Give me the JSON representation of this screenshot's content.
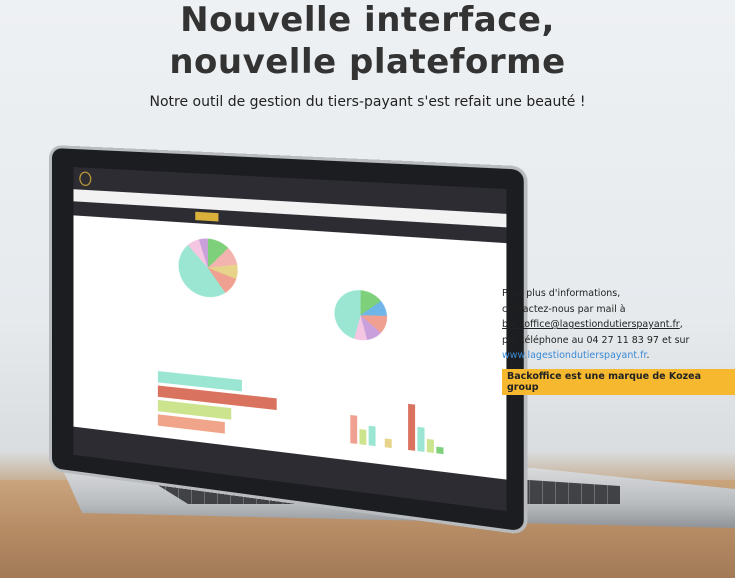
{
  "headline": {
    "line1": "Nouvelle interface,",
    "line2": "nouvelle plateforme"
  },
  "subtitle": "Notre outil de gestion du tiers-payant s'est refait une beauté !",
  "info": {
    "line1": "Pour plus d'informations,",
    "line2": "contactez-nous par mail à",
    "email": "backoffice@lagestiondutierspayant.fr",
    "email_suffix": ",",
    "line4": "par téléphone au 04 27 11 83 97 et sur",
    "website": "www.lagestiondutierspayant.fr",
    "website_suffix": "."
  },
  "badge": "Backoffice est une marque de Kozea group",
  "colors": {
    "accent": "#f5b82f",
    "link": "#3a8ad6",
    "screen_bar": "#2c2c32",
    "highlight": "#d9b13a"
  }
}
